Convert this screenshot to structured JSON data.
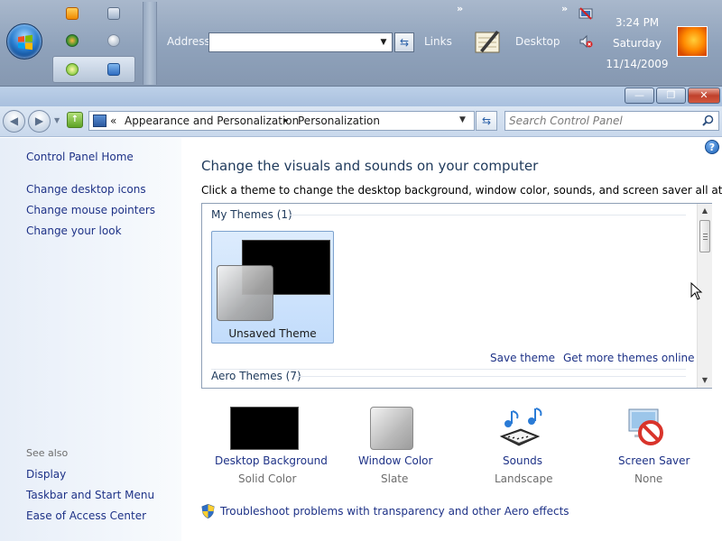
{
  "taskbar": {
    "address_label": "Address",
    "address_value": "",
    "links_label": "Links",
    "desktop_label": "Desktop",
    "clock": {
      "time": "3:24 PM",
      "day": "Saturday",
      "date": "11/14/2009"
    }
  },
  "window": {
    "minimize_glyph": "—",
    "maximize_glyph": "❐",
    "close_glyph": "✕"
  },
  "nav": {
    "breadcrumb_prefix": "«",
    "breadcrumb": [
      "Appearance and Personalization",
      "Personalization"
    ],
    "breadcrumb_sep": "▸",
    "search_placeholder": "Search Control Panel"
  },
  "sidebar": {
    "home": "Control Panel Home",
    "tasks": [
      "Change desktop icons",
      "Change mouse pointers",
      "Change your look"
    ],
    "see_also_label": "See also",
    "see_also": [
      "Display",
      "Taskbar and Start Menu",
      "Ease of Access Center"
    ]
  },
  "main": {
    "title": "Change the visuals and sounds on your computer",
    "description": "Click a theme to change the desktop background, window color, sounds, and screen saver all at once.",
    "help_glyph": "?",
    "groups": [
      {
        "header": "My Themes (1)"
      },
      {
        "header": "Aero Themes (7)"
      }
    ],
    "selected_theme": "Unsaved Theme",
    "save_theme_link": "Save theme",
    "more_themes_link": "Get more themes online"
  },
  "settings": [
    {
      "label": "Desktop Background",
      "value": "Solid Color",
      "icon": "desktop-background-swatch",
      "color": "#000000"
    },
    {
      "label": "Window Color",
      "value": "Slate",
      "icon": "window-color-swatch",
      "color": "#c8c8c8"
    },
    {
      "label": "Sounds",
      "value": "Landscape",
      "icon": "music-notes-icon",
      "color": "#2a7bd6"
    },
    {
      "label": "Screen Saver",
      "value": "None",
      "icon": "no-screensaver-icon",
      "color": "#d9342b"
    }
  ],
  "troubleshoot_link": "Troubleshoot problems with transparency and other Aero effects",
  "colors": {
    "link": "#1e3287",
    "title": "#1e395b",
    "selection": "#c2dcfb"
  }
}
